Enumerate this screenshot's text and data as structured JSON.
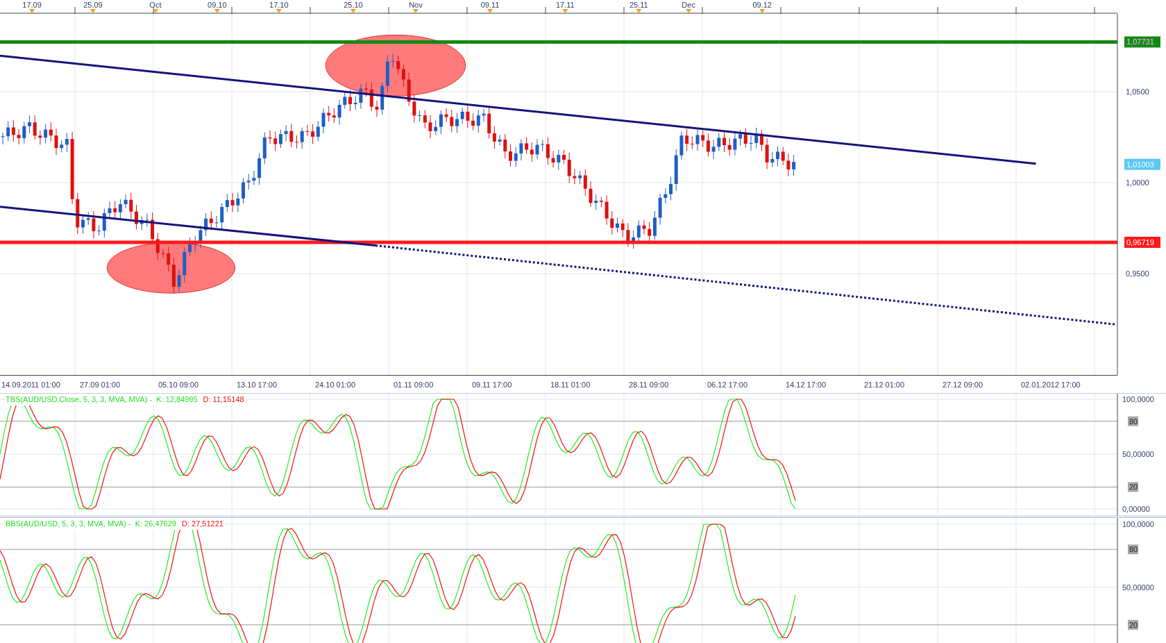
{
  "top_axis": {
    "labels": [
      "17.09",
      "25.09",
      "Oct",
      "09.10",
      "17.10",
      "25.10",
      "Nov",
      "09.11",
      "17.11",
      "25.11",
      "Dec",
      "09.12"
    ]
  },
  "main_chart": {
    "price_labels": [
      "1,0500",
      "1,0000",
      "0,9500"
    ],
    "levels": [
      {
        "kind": "resistance",
        "text": "1,07731",
        "color": "#138a13"
      },
      {
        "kind": "current",
        "text": "1,01003",
        "color": "#5bc8f5"
      },
      {
        "kind": "support",
        "text": "0,96719",
        "color": "#ff1a1a"
      }
    ]
  },
  "time_axis": {
    "labels": [
      "14.09.2011 01:00",
      "27.09 01:00",
      "05.10 09:00",
      "13.10 17:00",
      "24.10 01:00",
      "01.11 09:00",
      "09.11 17:00",
      "18.11 01:00",
      "28.11 09:00",
      "06.12 17:00",
      "14.12 17:00",
      "21.12 01:00",
      "27.12 09:00",
      "02.01.2012 17:00"
    ]
  },
  "panels": [
    {
      "title": "TBS(AUD/USD.Close, 5, 3, 3, MVA, MVA) -  K: 12,84995",
      "d_reading": "D: 11,15148",
      "axis": [
        {
          "text": "100,0000",
          "kind": "tick"
        },
        {
          "text": "80",
          "kind": "band"
        },
        {
          "text": "50,00000",
          "kind": "tick"
        },
        {
          "text": "20",
          "kind": "band"
        },
        {
          "text": "0,00000",
          "kind": "tick"
        }
      ]
    },
    {
      "title": "BBS(AUD/USD, 5, 3, 3, MVA, MVA) -  K: 26,47629",
      "d_reading": "D: 27,51221",
      "axis": [
        {
          "text": "100,0000",
          "kind": "tick"
        },
        {
          "text": "80",
          "kind": "band"
        },
        {
          "text": "50,00000",
          "kind": "tick"
        },
        {
          "text": "20",
          "kind": "band"
        }
      ]
    }
  ]
}
